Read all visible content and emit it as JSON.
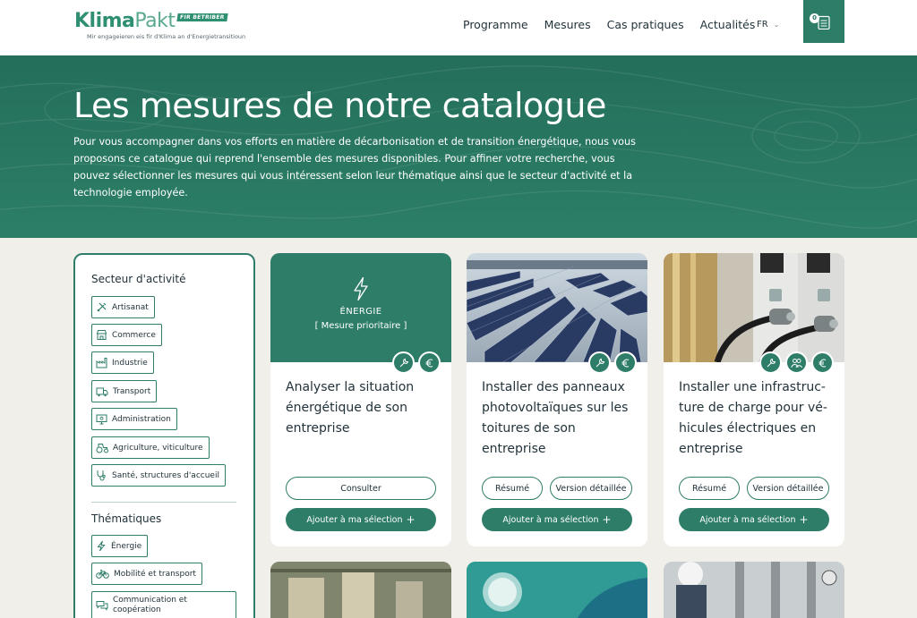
{
  "header": {
    "logo_main": "Klima",
    "logo_secondary": "Pakt",
    "logo_badge": "FIR BETRIBER",
    "logo_tagline": "Mir engageieren eis fir d'Klima an d'Energietransitioun",
    "nav": [
      "Programme",
      "Mesures",
      "Cas pratiques",
      "Actualités"
    ],
    "language": "FR",
    "cart_count": "0",
    "colors": {
      "primary": "#2e7d68",
      "logo": "#2e8f72"
    }
  },
  "hero": {
    "title": "Les mesures de notre catalogue",
    "text": "Pour vous accompagner dans vos efforts en matière de décarbonisation et de transition énergétique, nous vous proposons ce catalogue qui reprend l'ensemble des mesures disponibles. Pour affiner votre recherche, vous pouvez sélectionner les mesures qui vous intéressent selon leur thématique ainsi que le secteur d'activité et la technologie employée."
  },
  "filters": {
    "sector_heading": "Secteur d'activité",
    "sectors": [
      {
        "label": "Artisanat",
        "icon": "tools-icon"
      },
      {
        "label": "Commerce",
        "icon": "shop-icon"
      },
      {
        "label": "Industrie",
        "icon": "factory-icon"
      },
      {
        "label": "Transport",
        "icon": "truck-icon"
      },
      {
        "label": "Administration",
        "icon": "monitor-icon"
      },
      {
        "label": "Agriculture, viticulture",
        "icon": "tractor-icon"
      },
      {
        "label": "Santé, structures d'accueil",
        "icon": "stethoscope-icon"
      }
    ],
    "themes_heading": "Thématiques",
    "themes": [
      {
        "label": "Énergie",
        "icon": "lightning-icon"
      },
      {
        "label": "Mobilité et transport",
        "icon": "bicycle-icon"
      },
      {
        "label_line1": "Communication et",
        "label_line2": "coopération",
        "icon": "chat-icon"
      }
    ]
  },
  "cards": [
    {
      "top_label": "ÉNERGIE",
      "top_priority": "[ Mesure prioritaire ]",
      "title": "Analyser la situation énergétique de son entreprise",
      "badges": [
        "wrench-icon",
        "euro-icon"
      ],
      "consult": "Consulter",
      "add": "Ajouter à ma sélection"
    },
    {
      "image": "solar-panels-rooftop-photo",
      "title": "Installer des panneaux photovoltaïques sur les toitures de son entreprise",
      "badges": [
        "wrench-icon",
        "euro-icon"
      ],
      "summary": "Résumé",
      "detailed": "Version détaillée",
      "add": "Ajouter à ma sélection"
    },
    {
      "image": "ev-charging-station-photo",
      "title": "Installer une infrastruc-ture de charge pour vé-hicules électriques en entreprise",
      "title_lines": [
        "Installer une infrastruc-",
        "ture de charge pour vé-",
        "hicules électriques en",
        "entreprise"
      ],
      "badges": [
        "wrench-icon",
        "people-icon",
        "euro-icon"
      ],
      "summary": "Résumé",
      "detailed": "Version détaillée",
      "add": "Ajouter à ma sélection"
    }
  ]
}
